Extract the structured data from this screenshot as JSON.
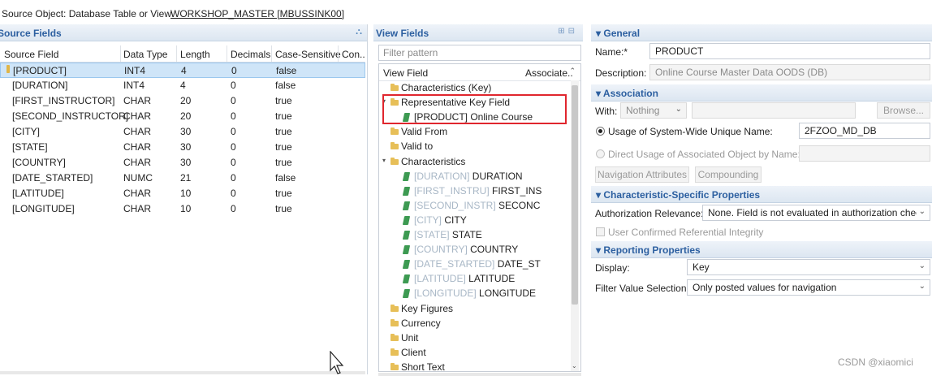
{
  "source_object": {
    "label": "Source Object:  Database Table or View",
    "value": "WORKSHOP_MASTER [MBUSSINK00]"
  },
  "source_fields": {
    "title": "Source Fields",
    "columns": [
      "Source Field",
      "Data Type",
      "Length",
      "Decimals",
      "Case-Sensitive",
      "Con.."
    ],
    "rows": [
      {
        "field": "[PRODUCT]",
        "type": "INT4",
        "length": "4",
        "decimals": "0",
        "case": "false",
        "key": true
      },
      {
        "field": "[DURATION]",
        "type": "INT4",
        "length": "4",
        "decimals": "0",
        "case": "false"
      },
      {
        "field": "[FIRST_INSTRUCTOR]",
        "type": "CHAR",
        "length": "20",
        "decimals": "0",
        "case": "true"
      },
      {
        "field": "[SECOND_INSTRUCTOR]",
        "type": "CHAR",
        "length": "20",
        "decimals": "0",
        "case": "true"
      },
      {
        "field": "[CITY]",
        "type": "CHAR",
        "length": "30",
        "decimals": "0",
        "case": "true"
      },
      {
        "field": "[STATE]",
        "type": "CHAR",
        "length": "30",
        "decimals": "0",
        "case": "true"
      },
      {
        "field": "[COUNTRY]",
        "type": "CHAR",
        "length": "30",
        "decimals": "0",
        "case": "true"
      },
      {
        "field": "[DATE_STARTED]",
        "type": "NUMC",
        "length": "21",
        "decimals": "0",
        "case": "false"
      },
      {
        "field": "[LATITUDE]",
        "type": "CHAR",
        "length": "10",
        "decimals": "0",
        "case": "true"
      },
      {
        "field": "[LONGITUDE]",
        "type": "CHAR",
        "length": "10",
        "decimals": "0",
        "case": "true"
      }
    ]
  },
  "view_fields": {
    "title": "View Fields",
    "filter_placeholder": "Filter pattern",
    "col_view_field": "View Field",
    "col_associate": "Associate..",
    "tree": [
      {
        "kind": "folder",
        "text": "Characteristics (Key)"
      },
      {
        "kind": "folder",
        "text": "Representative Key Field",
        "expanded": true
      },
      {
        "kind": "field",
        "tech": "",
        "text": "[PRODUCT] Online Course"
      },
      {
        "kind": "folder",
        "text": "Valid From"
      },
      {
        "kind": "folder",
        "text": "Valid to"
      },
      {
        "kind": "folder",
        "text": "Characteristics",
        "expanded": true
      },
      {
        "kind": "field",
        "tech": "[DURATION]",
        "text": "DURATION"
      },
      {
        "kind": "field",
        "tech": "[FIRST_INSTRU]",
        "text": "FIRST_INS"
      },
      {
        "kind": "field",
        "tech": "[SECOND_INSTR]",
        "text": "SECONC"
      },
      {
        "kind": "field",
        "tech": "[CITY]",
        "text": "CITY"
      },
      {
        "kind": "field",
        "tech": "[STATE]",
        "text": "STATE"
      },
      {
        "kind": "field",
        "tech": "[COUNTRY]",
        "text": "COUNTRY"
      },
      {
        "kind": "field",
        "tech": "[DATE_STARTED]",
        "text": "DATE_ST"
      },
      {
        "kind": "field",
        "tech": "[LATITUDE]",
        "text": "LATITUDE"
      },
      {
        "kind": "field",
        "tech": "[LONGITUDE]",
        "text": "LONGITUDE"
      },
      {
        "kind": "folder",
        "text": "Key Figures"
      },
      {
        "kind": "folder",
        "text": "Currency"
      },
      {
        "kind": "folder",
        "text": "Unit"
      },
      {
        "kind": "folder",
        "text": "Client"
      },
      {
        "kind": "folder",
        "text": "Short Text"
      }
    ]
  },
  "general": {
    "title": "General",
    "name_label": "Name:*",
    "name_value": "PRODUCT",
    "desc_label": "Description:",
    "desc_value": "Online Course Master Data OODS (DB)"
  },
  "association": {
    "title": "Association",
    "with_label": "With:",
    "with_value": "Nothing",
    "browse_label": "Browse...",
    "usage_label": "Usage of System-Wide Unique Name:",
    "usage_value": "2FZOO_MD_DB",
    "direct_label": "Direct Usage of Associated Object by Name:",
    "nav_attr_label": "Navigation Attributes",
    "compounding_label": "Compounding"
  },
  "char_props": {
    "title": "Characteristic-Specific Properties",
    "auth_label": "Authorization Relevance:",
    "auth_value": "None. Field is not evaluated in authorization check",
    "ref_integrity_label": "User Confirmed Referential Integrity"
  },
  "reporting": {
    "title": "Reporting Properties",
    "display_label": "Display:",
    "display_value": "Key",
    "filter_label": "Filter Value Selection:",
    "filter_value": "Only posted values for navigation"
  },
  "watermark": "CSDN @xiaomici"
}
